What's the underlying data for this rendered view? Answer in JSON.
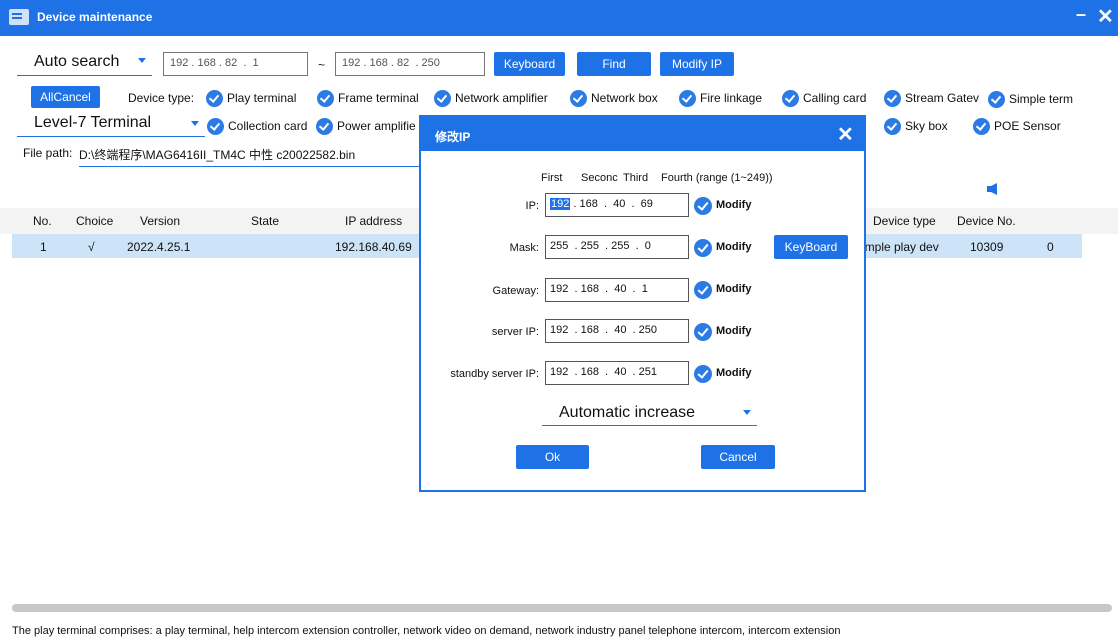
{
  "window": {
    "title": "Device maintenance"
  },
  "toolbar": {
    "search_mode": "Auto search",
    "ip_start": "192 . 168 . 82  .  1",
    "tilde": "~",
    "ip_end": "192 . 168 . 82  . 250",
    "keyboard_label": "Keyboard",
    "find_label": "Find",
    "modify_ip_label": "Modify IP",
    "allcancel_label": "AllCancel",
    "device_type_label": "Device type:",
    "level_select": "Level-7 Terminal",
    "file_path_label": "File path:",
    "file_path_value": "D:\\终端程序\\MAG6416II_TM4C 中性 c20022582.bin"
  },
  "device_types_row1": [
    "Play terminal",
    "Frame terminal",
    "Network amplifier",
    "Network box",
    "Fire linkage",
    "Calling card",
    "Stream Gatev",
    "Simple term"
  ],
  "device_types_row2": [
    "Collection card",
    "Power amplifie",
    "Sky box",
    "POE Sensor"
  ],
  "table": {
    "headers": {
      "no": "No.",
      "choice": "Choice",
      "version": "Version",
      "state": "State",
      "ip": "IP address",
      "device_type": "Device type",
      "device_no": "Device No."
    },
    "row": {
      "no": "1",
      "choice": "√",
      "version": "2022.4.25.1",
      "ip": "192.168.40.69",
      "device_type": "imple play dev",
      "device_no": "10309",
      "extra": "0"
    }
  },
  "footer_text": "The play terminal comprises: a play terminal, help intercom extension controller, network video on demand, network industry panel telephone intercom, intercom extension",
  "dialog": {
    "title": "修改IP",
    "col_first": "First",
    "col_second": "Seconc",
    "col_third": "Third",
    "col_fourth": "Fourth (range (1~249))",
    "ip_label": "IP:",
    "ip_sel": "192",
    "ip_rest": " . 168  .  40  .  69",
    "mask_label": "Mask:",
    "mask_value": "255  . 255  . 255  .  0",
    "gateway_label": "Gateway:",
    "gateway_value": "192  . 168  .  40  .  1",
    "server_label": "server IP:",
    "server_value": "192  . 168  .  40  . 250",
    "standby_label": "standby server IP:",
    "standby_value": "192  . 168  .  40  . 251",
    "modify_label": "Modify",
    "keyboard_label": "KeyBoard",
    "increase_mode": "Automatic increase",
    "ok_label": "Ok",
    "cancel_label": "Cancel"
  },
  "colors": {
    "accent": "#1e72e6",
    "selected_row": "#cce3f8",
    "check": "#2c7be5"
  }
}
